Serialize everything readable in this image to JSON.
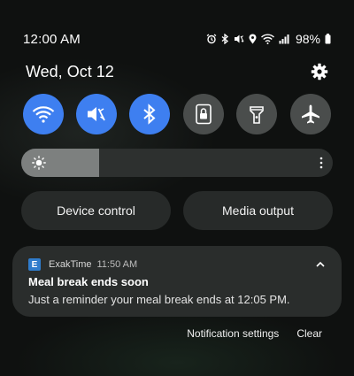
{
  "status_bar": {
    "time": "12:00 AM",
    "battery": "98%",
    "icons": [
      "alarm-icon",
      "bluetooth-icon",
      "mute-icon",
      "location-icon",
      "wifi-icon",
      "signal-icon",
      "battery-icon"
    ]
  },
  "header": {
    "date": "Wed, Oct 12"
  },
  "quick_toggles": [
    {
      "name": "wifi",
      "state": "on",
      "icon": "wifi-icon"
    },
    {
      "name": "sound",
      "state": "on",
      "icon": "mute-icon"
    },
    {
      "name": "bluetooth",
      "state": "on",
      "icon": "bluetooth-icon"
    },
    {
      "name": "screen-lock",
      "state": "off",
      "icon": "lock-icon"
    },
    {
      "name": "flashlight",
      "state": "off",
      "icon": "flashlight-icon"
    },
    {
      "name": "airplane-mode",
      "state": "off",
      "icon": "airplane-icon"
    }
  ],
  "brightness": {
    "level_fraction": 0.25
  },
  "buttons": {
    "device_control": "Device control",
    "media_output": "Media output"
  },
  "notification": {
    "app_initial": "E",
    "app_name": "ExakTime",
    "time": "11:50 AM",
    "title": "Meal break ends soon",
    "body": "Just a reminder your meal break ends at 12:05 PM."
  },
  "actions": {
    "settings": "Notification settings",
    "clear": "Clear"
  },
  "colors": {
    "toggle_on": "#3e7ff0",
    "toggle_off": "#4a4d4c",
    "app_badge": "#2f7ccc"
  }
}
